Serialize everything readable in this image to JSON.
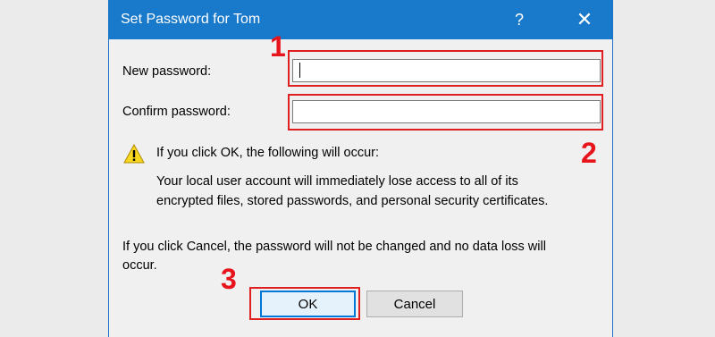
{
  "window": {
    "title": "Set Password for Tom",
    "help_glyph": "?",
    "close_glyph": "✕"
  },
  "form": {
    "new_password_label": "New password:",
    "new_password_value": "",
    "confirm_password_label": "Confirm password:",
    "confirm_password_value": ""
  },
  "warning": {
    "icon": "warning-icon",
    "heading": "If you click OK, the following will occur:",
    "body_line1": "Your local user account will immediately lose access to all of its",
    "body_line2": "encrypted files, stored passwords, and personal security certificates."
  },
  "cancel_note": {
    "line1": "If you click Cancel, the password will not be changed and no data loss will",
    "line2": "occur."
  },
  "buttons": {
    "ok": "OK",
    "cancel": "Cancel"
  },
  "annotations": {
    "step1": "1",
    "step2": "2",
    "step3": "3",
    "highlight_color": "#e02020"
  }
}
